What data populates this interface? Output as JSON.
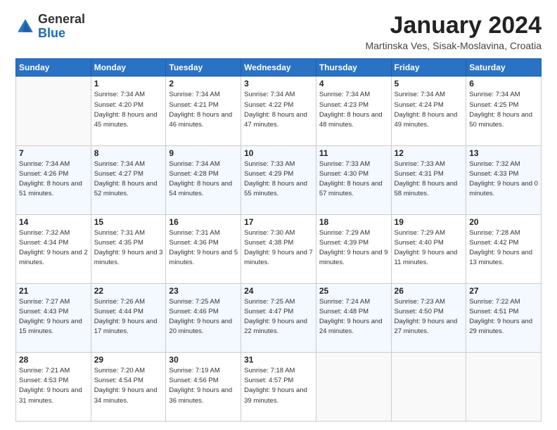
{
  "logo": {
    "general": "General",
    "blue": "Blue"
  },
  "title": "January 2024",
  "location": "Martinska Ves, Sisak-Moslavina, Croatia",
  "days_header": [
    "Sunday",
    "Monday",
    "Tuesday",
    "Wednesday",
    "Thursday",
    "Friday",
    "Saturday"
  ],
  "weeks": [
    [
      {
        "day": "",
        "empty": true
      },
      {
        "day": "1",
        "sunrise": "Sunrise: 7:34 AM",
        "sunset": "Sunset: 4:20 PM",
        "daylight": "Daylight: 8 hours and 45 minutes."
      },
      {
        "day": "2",
        "sunrise": "Sunrise: 7:34 AM",
        "sunset": "Sunset: 4:21 PM",
        "daylight": "Daylight: 8 hours and 46 minutes."
      },
      {
        "day": "3",
        "sunrise": "Sunrise: 7:34 AM",
        "sunset": "Sunset: 4:22 PM",
        "daylight": "Daylight: 8 hours and 47 minutes."
      },
      {
        "day": "4",
        "sunrise": "Sunrise: 7:34 AM",
        "sunset": "Sunset: 4:23 PM",
        "daylight": "Daylight: 8 hours and 48 minutes."
      },
      {
        "day": "5",
        "sunrise": "Sunrise: 7:34 AM",
        "sunset": "Sunset: 4:24 PM",
        "daylight": "Daylight: 8 hours and 49 minutes."
      },
      {
        "day": "6",
        "sunrise": "Sunrise: 7:34 AM",
        "sunset": "Sunset: 4:25 PM",
        "daylight": "Daylight: 8 hours and 50 minutes."
      }
    ],
    [
      {
        "day": "7",
        "sunrise": "Sunrise: 7:34 AM",
        "sunset": "Sunset: 4:26 PM",
        "daylight": "Daylight: 8 hours and 51 minutes."
      },
      {
        "day": "8",
        "sunrise": "Sunrise: 7:34 AM",
        "sunset": "Sunset: 4:27 PM",
        "daylight": "Daylight: 8 hours and 52 minutes."
      },
      {
        "day": "9",
        "sunrise": "Sunrise: 7:34 AM",
        "sunset": "Sunset: 4:28 PM",
        "daylight": "Daylight: 8 hours and 54 minutes."
      },
      {
        "day": "10",
        "sunrise": "Sunrise: 7:33 AM",
        "sunset": "Sunset: 4:29 PM",
        "daylight": "Daylight: 8 hours and 55 minutes."
      },
      {
        "day": "11",
        "sunrise": "Sunrise: 7:33 AM",
        "sunset": "Sunset: 4:30 PM",
        "daylight": "Daylight: 8 hours and 57 minutes."
      },
      {
        "day": "12",
        "sunrise": "Sunrise: 7:33 AM",
        "sunset": "Sunset: 4:31 PM",
        "daylight": "Daylight: 8 hours and 58 minutes."
      },
      {
        "day": "13",
        "sunrise": "Sunrise: 7:32 AM",
        "sunset": "Sunset: 4:33 PM",
        "daylight": "Daylight: 9 hours and 0 minutes."
      }
    ],
    [
      {
        "day": "14",
        "sunrise": "Sunrise: 7:32 AM",
        "sunset": "Sunset: 4:34 PM",
        "daylight": "Daylight: 9 hours and 2 minutes."
      },
      {
        "day": "15",
        "sunrise": "Sunrise: 7:31 AM",
        "sunset": "Sunset: 4:35 PM",
        "daylight": "Daylight: 9 hours and 3 minutes."
      },
      {
        "day": "16",
        "sunrise": "Sunrise: 7:31 AM",
        "sunset": "Sunset: 4:36 PM",
        "daylight": "Daylight: 9 hours and 5 minutes."
      },
      {
        "day": "17",
        "sunrise": "Sunrise: 7:30 AM",
        "sunset": "Sunset: 4:38 PM",
        "daylight": "Daylight: 9 hours and 7 minutes."
      },
      {
        "day": "18",
        "sunrise": "Sunrise: 7:29 AM",
        "sunset": "Sunset: 4:39 PM",
        "daylight": "Daylight: 9 hours and 9 minutes."
      },
      {
        "day": "19",
        "sunrise": "Sunrise: 7:29 AM",
        "sunset": "Sunset: 4:40 PM",
        "daylight": "Daylight: 9 hours and 11 minutes."
      },
      {
        "day": "20",
        "sunrise": "Sunrise: 7:28 AM",
        "sunset": "Sunset: 4:42 PM",
        "daylight": "Daylight: 9 hours and 13 minutes."
      }
    ],
    [
      {
        "day": "21",
        "sunrise": "Sunrise: 7:27 AM",
        "sunset": "Sunset: 4:43 PM",
        "daylight": "Daylight: 9 hours and 15 minutes."
      },
      {
        "day": "22",
        "sunrise": "Sunrise: 7:26 AM",
        "sunset": "Sunset: 4:44 PM",
        "daylight": "Daylight: 9 hours and 17 minutes."
      },
      {
        "day": "23",
        "sunrise": "Sunrise: 7:25 AM",
        "sunset": "Sunset: 4:46 PM",
        "daylight": "Daylight: 9 hours and 20 minutes."
      },
      {
        "day": "24",
        "sunrise": "Sunrise: 7:25 AM",
        "sunset": "Sunset: 4:47 PM",
        "daylight": "Daylight: 9 hours and 22 minutes."
      },
      {
        "day": "25",
        "sunrise": "Sunrise: 7:24 AM",
        "sunset": "Sunset: 4:48 PM",
        "daylight": "Daylight: 9 hours and 24 minutes."
      },
      {
        "day": "26",
        "sunrise": "Sunrise: 7:23 AM",
        "sunset": "Sunset: 4:50 PM",
        "daylight": "Daylight: 9 hours and 27 minutes."
      },
      {
        "day": "27",
        "sunrise": "Sunrise: 7:22 AM",
        "sunset": "Sunset: 4:51 PM",
        "daylight": "Daylight: 9 hours and 29 minutes."
      }
    ],
    [
      {
        "day": "28",
        "sunrise": "Sunrise: 7:21 AM",
        "sunset": "Sunset: 4:53 PM",
        "daylight": "Daylight: 9 hours and 31 minutes."
      },
      {
        "day": "29",
        "sunrise": "Sunrise: 7:20 AM",
        "sunset": "Sunset: 4:54 PM",
        "daylight": "Daylight: 9 hours and 34 minutes."
      },
      {
        "day": "30",
        "sunrise": "Sunrise: 7:19 AM",
        "sunset": "Sunset: 4:56 PM",
        "daylight": "Daylight: 9 hours and 36 minutes."
      },
      {
        "day": "31",
        "sunrise": "Sunrise: 7:18 AM",
        "sunset": "Sunset: 4:57 PM",
        "daylight": "Daylight: 9 hours and 39 minutes."
      },
      {
        "day": "",
        "empty": true
      },
      {
        "day": "",
        "empty": true
      },
      {
        "day": "",
        "empty": true
      }
    ]
  ]
}
